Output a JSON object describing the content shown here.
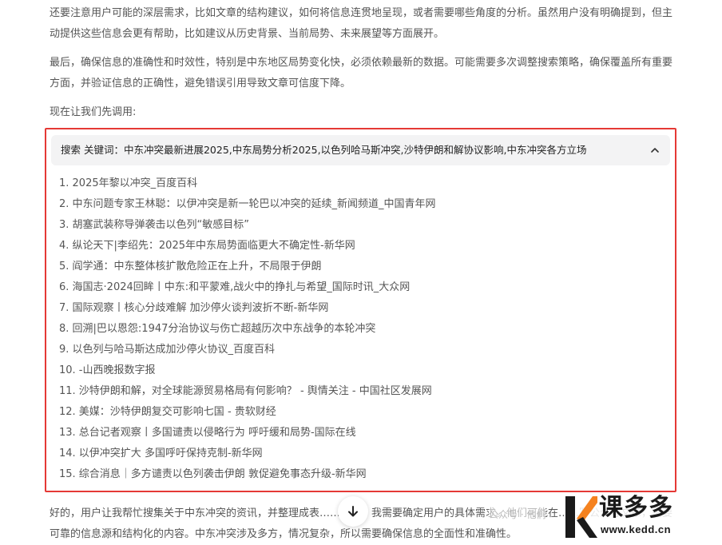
{
  "paragraphs": {
    "p1": "还要注意用户可能的深层需求，比如文章的结构建议，如何将信息连贯地呈现，或者需要哪些角度的分析。虽然用户没有明确提到，但主动提供这些信息会更有帮助，比如建议从历史背景、当前局势、未来展望等方面展开。",
    "p2": "最后，确保信息的准确性和时效性，特别是中东地区局势变化快，必须依赖最新的数据。可能需要多次调整搜索策略，确保覆盖所有重要方面，并验证信息的正确性，避免错误引用导致文章可信度下降。",
    "p3": "现在让我们先调用:",
    "p4": "好的，用户让我帮忙搜集关于中东冲突的资讯，并整理成表……首先，我需要确定用户的具体需求。他们可能在……写公众号文章，需要可靠的信息源和结构化的内容。中东冲突涉及多方，情况复杂，所以需要确保信息的全面性和准确性。"
  },
  "search": {
    "query": "搜索 关键词：中东冲突最新进展2025,中东局势分析2025,以色列哈马斯冲突,沙特伊朗和解协议影响,中东冲突各方立场",
    "results": [
      "1. 2025年黎以冲突_百度百科",
      "2. 中东问题专家王林聪：以伊冲突是新一轮巴以冲突的延续_新闻频道_中国青年网",
      "3. 胡塞武装称导弹袭击以色列“敏感目标”",
      "4. 纵论天下|李绍先：2025年中东局势面临更大不确定性-新华网",
      "5. 阎学通：中东整体核扩散危险正在上升，不局限于伊朗",
      "6. 海国志·2024回眸丨中东:和平蒙难,战火中的挣扎与希望_国际时讯_大众网",
      "7. 国际观察丨核心分歧难解 加沙停火谈判波折不断-新华网",
      "8. 回溯|巴以恩怨:1947分治协议与伤亡超越历次中东战争的本轮冲突",
      "9. 以色列与哈马斯达成加沙停火协议_百度百科",
      "10. -山西晚报数字报",
      "11. 沙特伊朗和解，对全球能源贸易格局有何影响？ - 舆情关注 - 中国社区发展网",
      "12. 美媒：沙特伊朗复交可影响七国 - 贵软财经",
      "13. 总台记者观察丨多国谴责以侵略行为 呼吁缓和局势-国际在线",
      "14. 以伊冲突扩大 多国呼吁保持克制-新华网",
      "15. 综合消息｜多方谴责以色列袭击伊朗 敦促避免事态升级-新华网"
    ]
  },
  "watermark": {
    "wechat": "公众号 · 他们",
    "brand": "课多多",
    "url": "www.kedd.cn"
  },
  "colors": {
    "highlight_border": "#e53935",
    "header_bg": "#f3f3f4",
    "body_text": "#555555"
  }
}
